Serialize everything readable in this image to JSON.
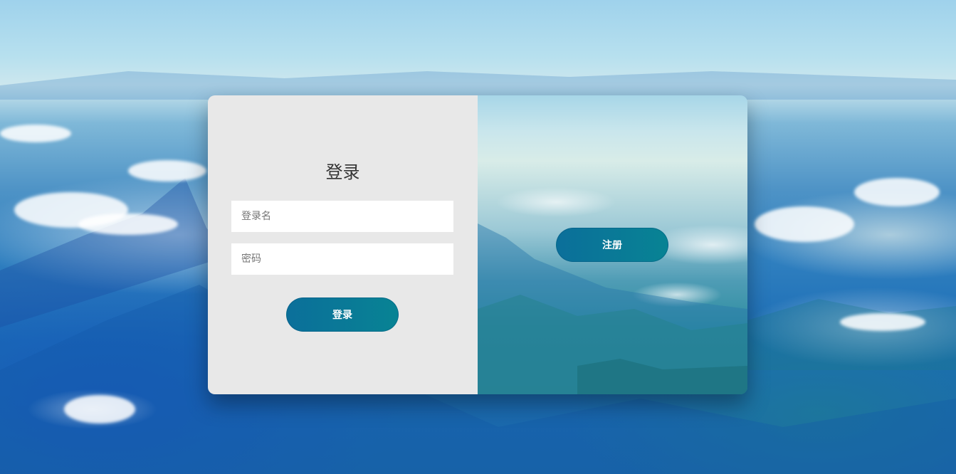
{
  "login": {
    "title": "登录",
    "username_placeholder": "登录名",
    "password_placeholder": "密码",
    "submit_label": "登录"
  },
  "register": {
    "button_label": "注册"
  },
  "colors": {
    "button_gradient_start": "#0b6f9a",
    "button_gradient_end": "#088394",
    "left_panel_bg": "#e8e8e8"
  }
}
